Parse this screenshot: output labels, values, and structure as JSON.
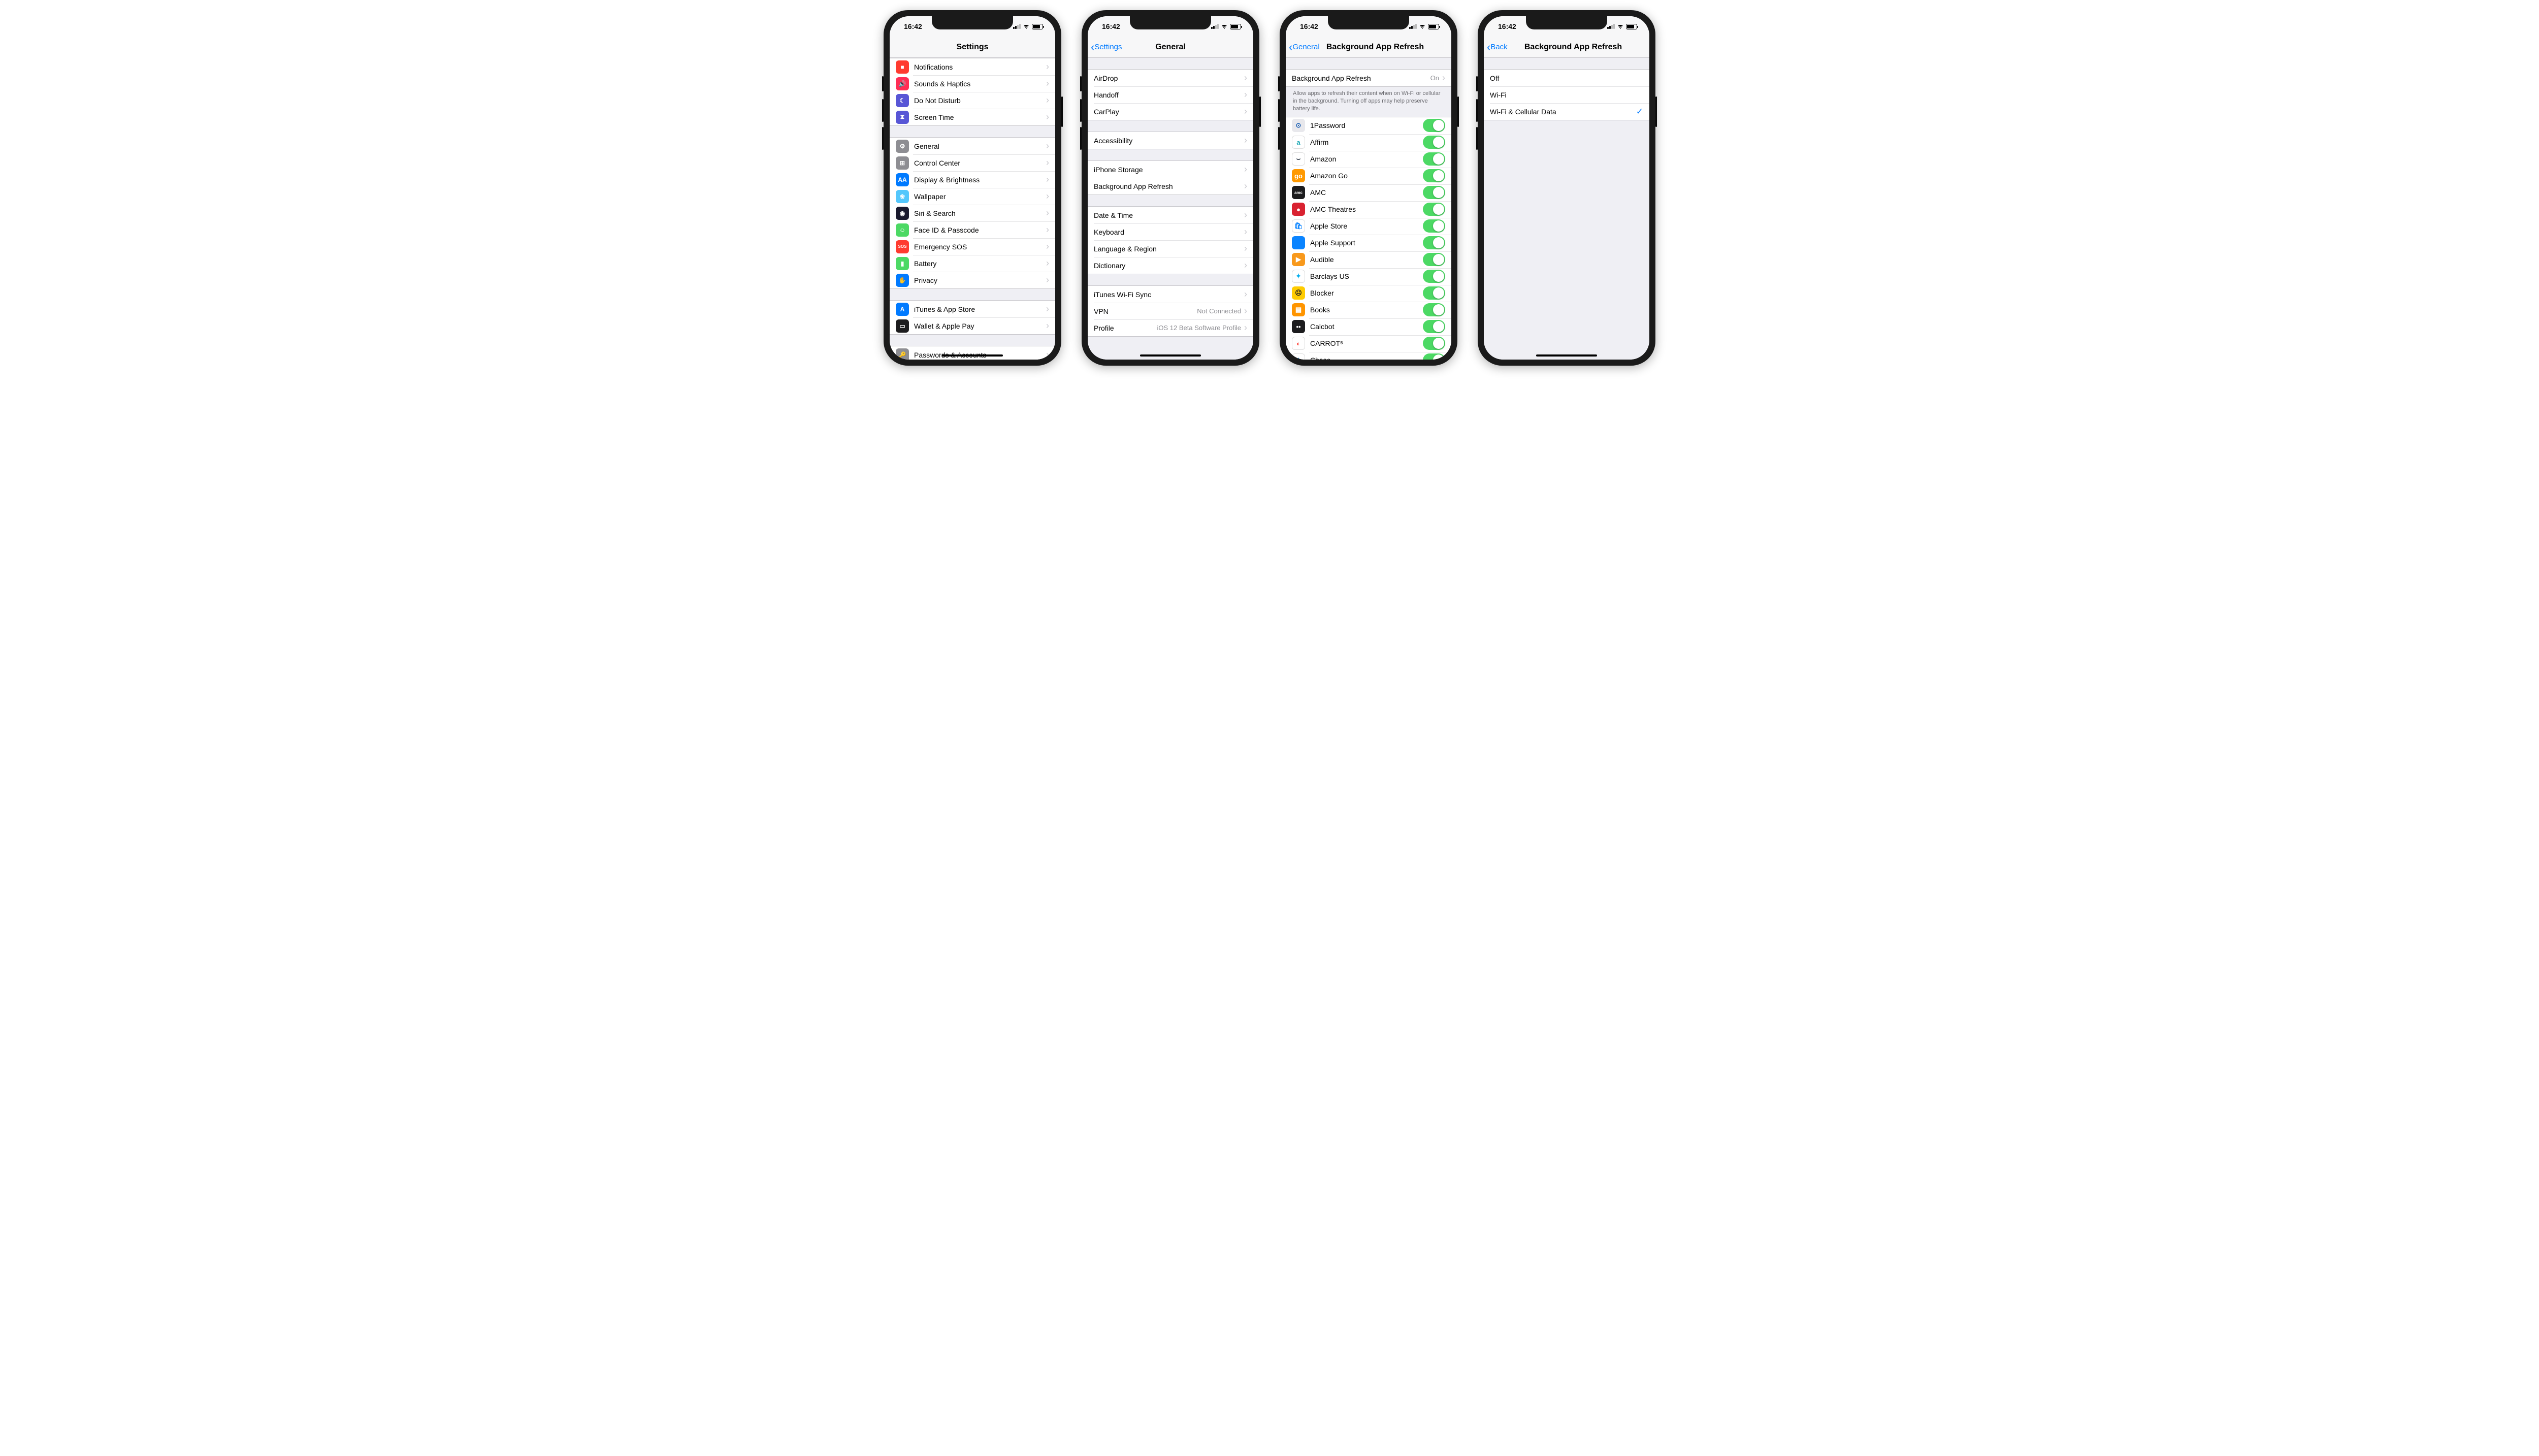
{
  "status": {
    "time": "16:42"
  },
  "screen1": {
    "title": "Settings",
    "groups": [
      [
        {
          "label": "Notifications",
          "icon_bg": "#ff3b30",
          "glyph": "■"
        },
        {
          "label": "Sounds & Haptics",
          "icon_bg": "#ff2d55",
          "glyph": "🔊"
        },
        {
          "label": "Do Not Disturb",
          "icon_bg": "#5856d6",
          "glyph": "☾"
        },
        {
          "label": "Screen Time",
          "icon_bg": "#5856d6",
          "glyph": "⧗"
        }
      ],
      [
        {
          "label": "General",
          "icon_bg": "#8e8e93",
          "glyph": "⚙"
        },
        {
          "label": "Control Center",
          "icon_bg": "#8e8e93",
          "glyph": "⊞"
        },
        {
          "label": "Display & Brightness",
          "icon_bg": "#007aff",
          "glyph": "AA"
        },
        {
          "label": "Wallpaper",
          "icon_bg": "#54c7fc",
          "glyph": "❀"
        },
        {
          "label": "Siri & Search",
          "icon_bg": "#1a1a2e",
          "glyph": "◉"
        },
        {
          "label": "Face ID & Passcode",
          "icon_bg": "#4cd964",
          "glyph": "☺"
        },
        {
          "label": "Emergency SOS",
          "icon_bg": "#ff3b30",
          "glyph": "SOS"
        },
        {
          "label": "Battery",
          "icon_bg": "#4cd964",
          "glyph": "▮"
        },
        {
          "label": "Privacy",
          "icon_bg": "#007aff",
          "glyph": "✋"
        }
      ],
      [
        {
          "label": "iTunes & App Store",
          "icon_bg": "#007aff",
          "glyph": "A"
        },
        {
          "label": "Wallet & Apple Pay",
          "icon_bg": "#1c1c1e",
          "glyph": "▭"
        }
      ],
      [
        {
          "label": "Passwords & Accounts",
          "icon_bg": "#8e8e93",
          "glyph": "🔑"
        }
      ]
    ]
  },
  "screen2": {
    "back": "Settings",
    "title": "General",
    "groups": [
      [
        {
          "label": "AirDrop"
        },
        {
          "label": "Handoff"
        },
        {
          "label": "CarPlay"
        }
      ],
      [
        {
          "label": "Accessibility"
        }
      ],
      [
        {
          "label": "iPhone Storage"
        },
        {
          "label": "Background App Refresh"
        }
      ],
      [
        {
          "label": "Date & Time"
        },
        {
          "label": "Keyboard"
        },
        {
          "label": "Language & Region"
        },
        {
          "label": "Dictionary"
        }
      ],
      [
        {
          "label": "iTunes Wi-Fi Sync"
        },
        {
          "label": "VPN",
          "detail": "Not Connected"
        },
        {
          "label": "Profile",
          "detail": "iOS 12 Beta Software Profile"
        }
      ]
    ]
  },
  "screen3": {
    "back": "General",
    "title": "Background App Refresh",
    "master": {
      "label": "Background App Refresh",
      "value": "On"
    },
    "footer": "Allow apps to refresh their content when on Wi-Fi or cellular in the background. Turning off apps may help preserve battery life.",
    "apps": [
      {
        "label": "1Password",
        "bg": "#e8e8ec",
        "fg": "#1a5fb4",
        "g": "⊙"
      },
      {
        "label": "Affirm",
        "bg": "#ffffff",
        "fg": "#0fa3b1",
        "g": "a",
        "border": true
      },
      {
        "label": "Amazon",
        "bg": "#ffffff",
        "fg": "#232f3e",
        "g": "⌣",
        "border": true
      },
      {
        "label": "Amazon Go",
        "bg": "#ff9900",
        "fg": "#fff",
        "g": "go"
      },
      {
        "label": "AMC",
        "bg": "#1c1c1e",
        "fg": "#fff",
        "g": "amc"
      },
      {
        "label": "AMC Theatres",
        "bg": "#d92231",
        "fg": "#fff",
        "g": "●"
      },
      {
        "label": "Apple Store",
        "bg": "#ffffff",
        "fg": "#0a84ff",
        "g": "🛍",
        "border": true
      },
      {
        "label": "Apple Support",
        "bg": "#0a84ff",
        "fg": "#fff",
        "g": ""
      },
      {
        "label": "Audible",
        "bg": "#f8991c",
        "fg": "#fff",
        "g": "▶"
      },
      {
        "label": "Barclays US",
        "bg": "#ffffff",
        "fg": "#00aeef",
        "g": "✦",
        "border": true
      },
      {
        "label": "Blocker",
        "bg": "#ffcc00",
        "fg": "#1c1c1e",
        "g": "☹"
      },
      {
        "label": "Books",
        "bg": "#ff9500",
        "fg": "#fff",
        "g": "▤"
      },
      {
        "label": "Calcbot",
        "bg": "#1c1c1e",
        "fg": "#fff",
        "g": "••"
      },
      {
        "label": "CARROT⁵",
        "bg": "#ffffff",
        "fg": "#ff3b30",
        "g": "◐",
        "border": true
      },
      {
        "label": "Chase",
        "bg": "#ffffff",
        "fg": "#117aca",
        "g": "◇",
        "border": true
      }
    ]
  },
  "screen4": {
    "back": "Back",
    "title": "Background App Refresh",
    "options": [
      {
        "label": "Off",
        "selected": false
      },
      {
        "label": "Wi-Fi",
        "selected": false
      },
      {
        "label": "Wi-Fi & Cellular Data",
        "selected": true
      }
    ]
  }
}
